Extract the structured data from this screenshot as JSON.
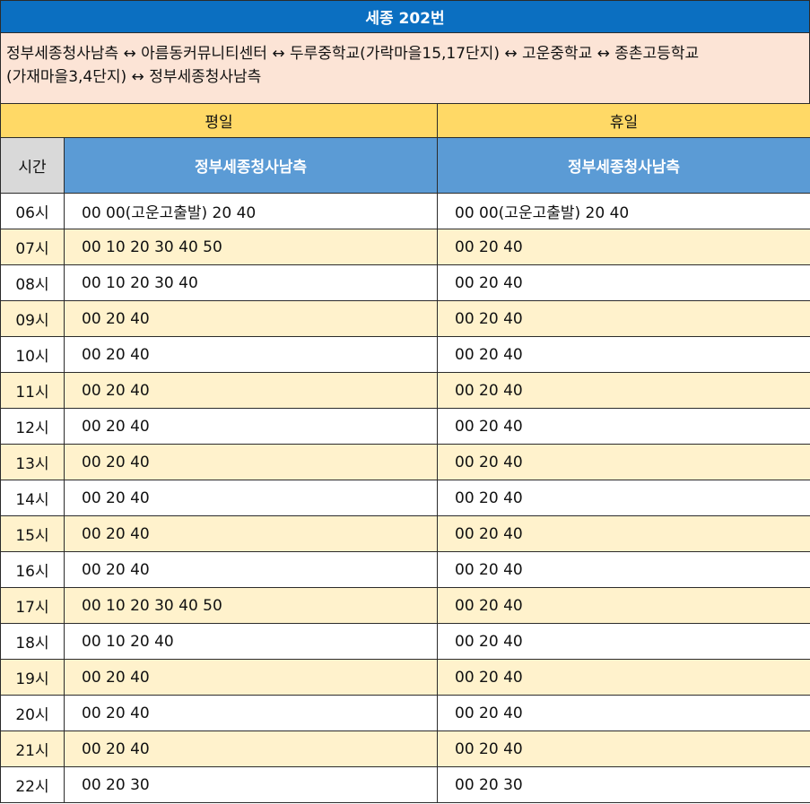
{
  "title": "세종 202번",
  "route": "정부세종청사남측 ↔ 아름동커뮤니티센터 ↔ 두루중학교(가락마을15,17단지) ↔ 고운중학교 ↔ 종촌고등학교(가재마을3,4단지) ↔ 정부세종청사남측",
  "headers": {
    "weekday": "평일",
    "holiday": "휴일",
    "time": "시간",
    "weekday_dest": "정부세종청사남측",
    "holiday_dest": "정부세종청사남측"
  },
  "rows": [
    {
      "hour": "06시",
      "weekday": "00 00(고운고출발) 20 40",
      "holiday": "00 00(고운고출발) 20 40"
    },
    {
      "hour": "07시",
      "weekday": "00 10 20 30 40 50",
      "holiday": "00 20 40"
    },
    {
      "hour": "08시",
      "weekday": "00 10 20 30 40",
      "holiday": "00 20 40"
    },
    {
      "hour": "09시",
      "weekday": "00 20 40",
      "holiday": "00 20 40"
    },
    {
      "hour": "10시",
      "weekday": "00 20 40",
      "holiday": "00 20 40"
    },
    {
      "hour": "11시",
      "weekday": "00 20 40",
      "holiday": "00 20 40"
    },
    {
      "hour": "12시",
      "weekday": "00 20 40",
      "holiday": "00 20 40"
    },
    {
      "hour": "13시",
      "weekday": "00 20 40",
      "holiday": "00 20 40"
    },
    {
      "hour": "14시",
      "weekday": "00 20 40",
      "holiday": "00 20 40"
    },
    {
      "hour": "15시",
      "weekday": "00 20 40",
      "holiday": "00 20 40"
    },
    {
      "hour": "16시",
      "weekday": "00 20 40",
      "holiday": "00 20 40"
    },
    {
      "hour": "17시",
      "weekday": "00 10 20 30 40 50",
      "holiday": "00 20 40"
    },
    {
      "hour": "18시",
      "weekday": "00 10 20 40",
      "holiday": "00 20 40"
    },
    {
      "hour": "19시",
      "weekday": "00 20 40",
      "holiday": "00 20 40"
    },
    {
      "hour": "20시",
      "weekday": "00 20 40",
      "holiday": "00 20 40"
    },
    {
      "hour": "21시",
      "weekday": "00 20 40",
      "holiday": "00 20 40"
    },
    {
      "hour": "22시",
      "weekday": "00 20 30",
      "holiday": "00 20 30"
    }
  ],
  "colors": {
    "title_bg": "#0b6fc1",
    "route_bg": "#fce4d6",
    "day_header_bg": "#ffd966",
    "dest_header_bg": "#5b9bd5",
    "time_header_bg": "#d9d9d9",
    "alt_row_bg": "#fff2cc"
  }
}
